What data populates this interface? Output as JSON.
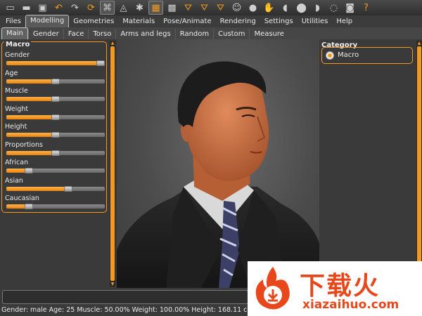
{
  "toolbar": {
    "icons": [
      "window-icon",
      "save-icon",
      "load-icon",
      "undo-icon",
      "redo-icon",
      "reset-icon",
      "smooth-icon",
      "wireframe-icon",
      "skeleton-icon",
      "grid-icon",
      "checker-icon",
      "front-view-icon",
      "back-view-icon",
      "side-view-icon",
      "face-mask-icon",
      "head-icon",
      "hand-icon",
      "foot-icon",
      "sphere-icon",
      "shoes-icon",
      "orbit-icon",
      "screenshot-icon",
      "help-icon"
    ]
  },
  "menus": [
    "Files",
    "Modelling",
    "Geometries",
    "Materials",
    "Pose/Animate",
    "Rendering",
    "Settings",
    "Utilities",
    "Help"
  ],
  "active_menu": "Modelling",
  "tabs": [
    "Main",
    "Gender",
    "Face",
    "Torso",
    "Arms and legs",
    "Random",
    "Custom",
    "Measure"
  ],
  "active_tab": "Main",
  "macro": {
    "title": "Macro",
    "sliders": [
      {
        "label": "Gender",
        "value": 1.0
      },
      {
        "label": "Age",
        "value": 0.5
      },
      {
        "label": "Muscle",
        "value": 0.5
      },
      {
        "label": "Weight",
        "value": 0.5
      },
      {
        "label": "Height",
        "value": 0.5
      },
      {
        "label": "Proportions",
        "value": 0.5
      },
      {
        "label": "African",
        "value": 0.2
      },
      {
        "label": "Asian",
        "value": 0.64
      },
      {
        "label": "Caucasian",
        "value": 0.2
      }
    ]
  },
  "category": {
    "title": "Category",
    "option": "Macro"
  },
  "status": "Gender: male Age: 25 Muscle: 50.00% Weight: 100.00% Height: 168.11 cm",
  "watermark": {
    "cn": "下载火",
    "url": "xiazaihuo.com"
  },
  "colors": {
    "accent": "#f39a1e",
    "panel_bg": "#3a3a3a",
    "watermark": "#e8471c"
  }
}
